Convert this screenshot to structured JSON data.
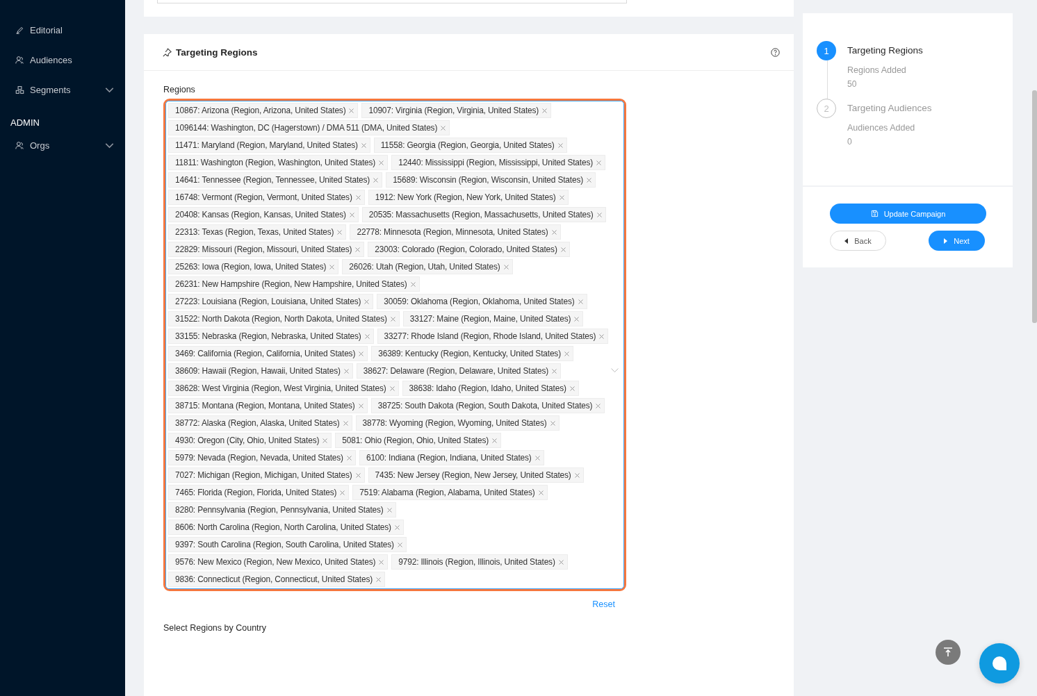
{
  "sidebar": {
    "items": [
      {
        "label": "Editorial",
        "kind": "brush",
        "expandable": false
      },
      {
        "label": "Audiences",
        "kind": "users",
        "expandable": false
      },
      {
        "label": "Segments",
        "kind": "blocks",
        "expandable": true
      }
    ],
    "sections": [
      {
        "title": "ADMIN",
        "items": [
          {
            "label": "Orgs",
            "kind": "users",
            "expandable": true
          }
        ]
      }
    ]
  },
  "card": {
    "title": "Targeting Regions",
    "field_label": "Regions",
    "tags": [
      "10867: Arizona (Region, Arizona, United States)",
      "10907: Virginia (Region, Virginia, United States)",
      "1096144: Washington,  DC (Hagerstown) / DMA 511 (DMA, United States)",
      "11471: Maryland (Region, Maryland, United States)",
      "11558: Georgia (Region, Georgia, United States)",
      "11811: Washington (Region, Washington, United States)",
      "12440: Mississippi (Region, Mississippi, United States)",
      "14641: Tennessee (Region, Tennessee, United States)",
      "15689: Wisconsin (Region, Wisconsin, United States)",
      "16748: Vermont (Region, Vermont, United States)",
      "1912: New York (Region, New York, United States)",
      "20408: Kansas (Region, Kansas, United States)",
      "20535: Massachusetts (Region, Massachusetts, United States)",
      "22313: Texas (Region, Texas, United States)",
      "22778: Minnesota (Region, Minnesota, United States)",
      "22829: Missouri (Region, Missouri, United States)",
      "23003: Colorado (Region, Colorado, United States)",
      "25263: Iowa (Region, Iowa, United States)",
      "26026: Utah (Region, Utah, United States)",
      "26231: New Hampshire (Region, New Hampshire, United States)",
      "27223: Louisiana (Region, Louisiana, United States)",
      "30059: Oklahoma (Region, Oklahoma, United States)",
      "31522: North Dakota (Region, North Dakota, United States)",
      "33127: Maine (Region, Maine, United States)",
      "33155: Nebraska (Region, Nebraska, United States)",
      "33277: Rhode Island (Region, Rhode Island, United States)",
      "3469: California (Region, California, United States)",
      "36389: Kentucky (Region, Kentucky, United States)",
      "38609: Hawaii (Region, Hawaii, United States)",
      "38627: Delaware (Region, Delaware, United States)",
      "38628: West Virginia (Region, West Virginia, United States)",
      "38638: Idaho (Region, Idaho, United States)",
      "38715: Montana (Region, Montana, United States)",
      "38725: South Dakota (Region, South Dakota, United States)",
      "38772: Alaska (Region, Alaska, United States)",
      "38778: Wyoming (Region, Wyoming, United States)",
      "4930: Oregon (City, Ohio, United States)",
      "5081: Ohio (Region, Ohio, United States)",
      "5979: Nevada (Region, Nevada, United States)",
      "6100: Indiana (Region, Indiana, United States)",
      "7027: Michigan (Region, Michigan, United States)",
      "7435: New Jersey (Region, New Jersey, United States)",
      "7465: Florida (Region, Florida, United States)",
      "7519: Alabama (Region, Alabama, United States)",
      "8280: Pennsylvania (Region, Pennsylvania, United States)",
      "8606: North Carolina (Region, North Carolina, United States)",
      "9397: South Carolina (Region, South Carolina, United States)",
      "9576: New Mexico (Region, New Mexico, United States)",
      "9792: Illinois (Region, Illinois, United States)",
      "9836: Connecticut (Region, Connecticut, United States)"
    ],
    "reset": "Reset",
    "next_label": "Select Regions by Country"
  },
  "steps": [
    {
      "number": "1",
      "title": "Targeting Regions",
      "subtitle": "Regions Added",
      "value": "50",
      "selected": true
    },
    {
      "number": "2",
      "title": "Targeting Audiences",
      "subtitle": "Audiences Added",
      "value": "0",
      "selected": false
    }
  ],
  "actions": {
    "primary": "Update Campaign",
    "back": "Back",
    "next": "Next"
  }
}
